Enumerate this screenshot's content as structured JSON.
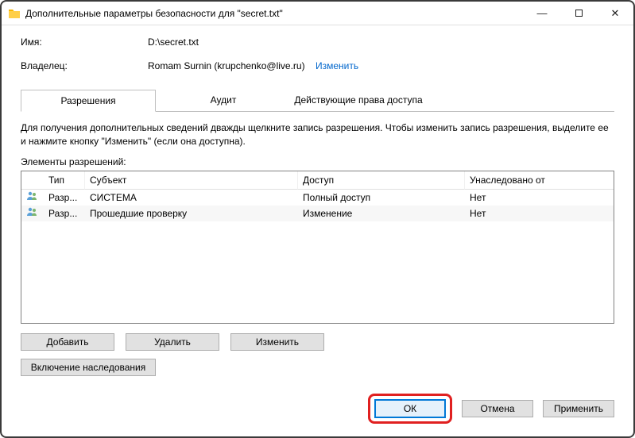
{
  "window": {
    "title": "Дополнительные параметры безопасности  для \"secret.txt\""
  },
  "info": {
    "name_label": "Имя:",
    "name_value": "D:\\secret.txt",
    "owner_label": "Владелец:",
    "owner_value": "Romam Surnin (krupchenko@live.ru)",
    "change_link": "Изменить"
  },
  "tabs": {
    "permissions": "Разрешения",
    "audit": "Аудит",
    "effective": "Действующие права доступа"
  },
  "help": "Для получения дополнительных сведений дважды щелкните запись разрешения. Чтобы изменить запись разрешения, выделите ее и нажмите кнопку \"Изменить\" (если она доступна).",
  "elements_label": "Элементы разрешений:",
  "table": {
    "headers": {
      "type": "Тип",
      "subject": "Субъект",
      "access": "Доступ",
      "inherited": "Унаследовано от"
    },
    "rows": [
      {
        "type": "Разр...",
        "subject": "СИСТЕМА",
        "access": "Полный доступ",
        "inherited": "Нет"
      },
      {
        "type": "Разр...",
        "subject": "Прошедшие проверку",
        "access": "Изменение",
        "inherited": "Нет"
      }
    ]
  },
  "buttons": {
    "add": "Добавить",
    "remove": "Удалить",
    "edit": "Изменить",
    "enable_inherit": "Включение наследования",
    "ok": "ОК",
    "cancel": "Отмена",
    "apply": "Применить"
  }
}
